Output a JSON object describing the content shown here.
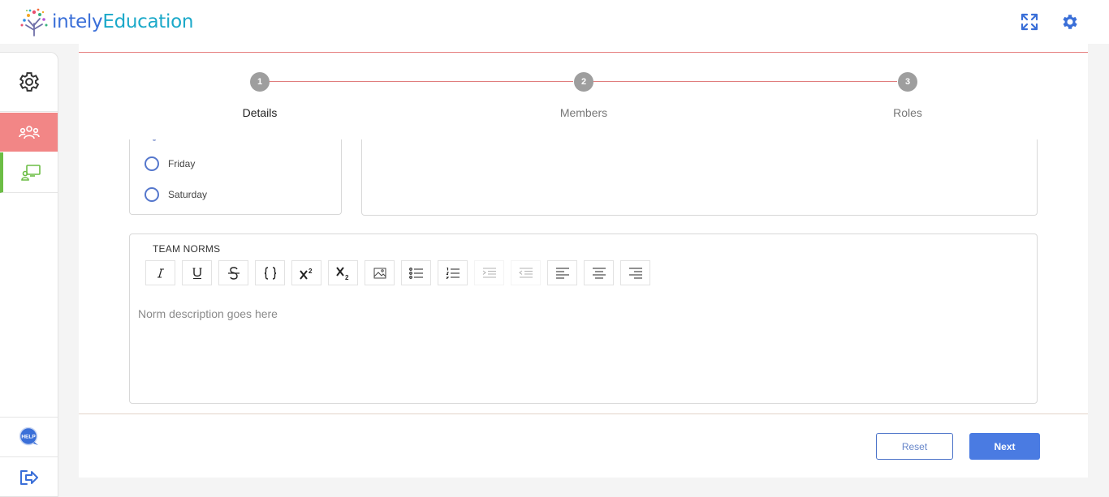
{
  "brand": {
    "name_part1": "intely",
    "name_part2": "Education"
  },
  "header": {
    "icons": [
      "fullscreen-icon",
      "gear-icon"
    ]
  },
  "sidebar": {
    "items": [
      {
        "name": "settings",
        "icon": "gear-icon"
      },
      {
        "name": "teams",
        "icon": "team-icon",
        "active": true
      },
      {
        "name": "classroom",
        "icon": "classroom-icon"
      },
      {
        "name": "help",
        "icon": "help-icon",
        "badge": "HELP"
      },
      {
        "name": "logout",
        "icon": "logout-icon"
      }
    ]
  },
  "stepper": {
    "steps": [
      {
        "number": "1",
        "label": "Details",
        "active": true
      },
      {
        "number": "2",
        "label": "Members",
        "active": false
      },
      {
        "number": "3",
        "label": "Roles",
        "active": false
      }
    ]
  },
  "days": [
    {
      "label": "Friday",
      "selected": false
    },
    {
      "label": "Saturday",
      "selected": false
    }
  ],
  "norms": {
    "title": "TEAM NORMS",
    "placeholder": "Norm description goes here",
    "toolbar": [
      {
        "name": "italic",
        "glyph": "I"
      },
      {
        "name": "underline",
        "glyph": "U"
      },
      {
        "name": "strikethrough",
        "glyph": "S"
      },
      {
        "name": "code",
        "glyph": "{}"
      },
      {
        "name": "superscript",
        "glyph": "X2"
      },
      {
        "name": "subscript",
        "glyph": "X2"
      },
      {
        "name": "image",
        "glyph": "image-icon"
      },
      {
        "name": "bullet-list",
        "glyph": "bullet-list-icon"
      },
      {
        "name": "numbered-list",
        "glyph": "numbered-list-icon"
      },
      {
        "name": "indent",
        "glyph": "indent-icon",
        "disabled": true
      },
      {
        "name": "outdent",
        "glyph": "outdent-icon",
        "disabled": true
      },
      {
        "name": "align-left",
        "glyph": "align-left-icon"
      },
      {
        "name": "align-center",
        "glyph": "align-center-icon"
      },
      {
        "name": "align-right",
        "glyph": "align-right-icon"
      }
    ]
  },
  "actions": {
    "reset_label": "Reset",
    "next_label": "Next"
  },
  "colors": {
    "accent": "#4a7be2",
    "sidebar_active": "#f28686",
    "stepper_line": "#e07d7d",
    "classroom_accent": "#6cbd45"
  }
}
